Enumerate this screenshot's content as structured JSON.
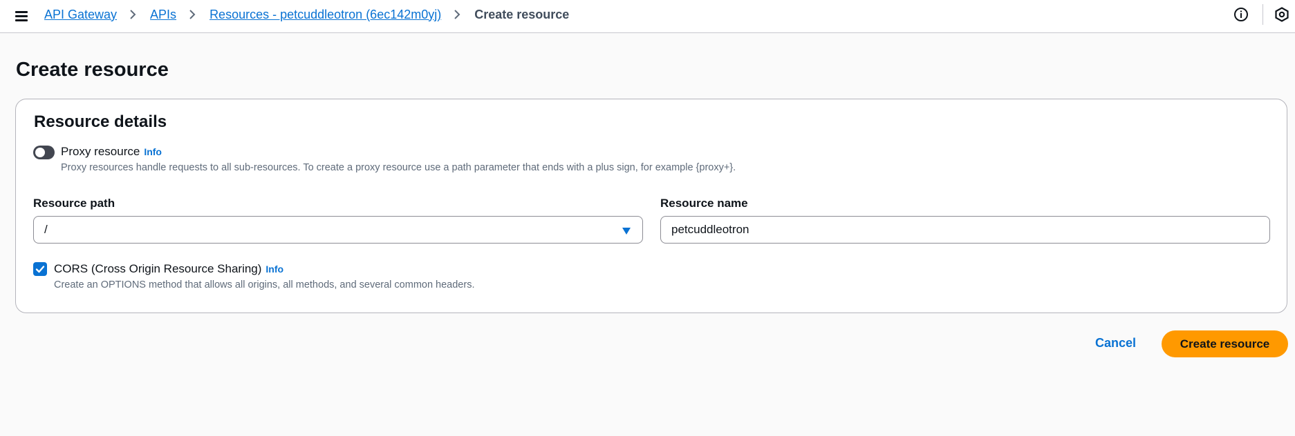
{
  "header": {
    "menu_icon": "hamburger-menu-icon",
    "breadcrumbs": [
      {
        "label": "API Gateway"
      },
      {
        "label": "APIs"
      },
      {
        "label": "Resources - petcuddleotron (6ec142m0yj)"
      },
      {
        "label": "Create resource"
      }
    ],
    "right_icons": [
      "info-circle-icon",
      "settings-hexagon-icon"
    ]
  },
  "page": {
    "title": "Create resource"
  },
  "resource_details": {
    "title": "Resource details",
    "proxy": {
      "label": "Proxy resource",
      "info": "Info",
      "description": "Proxy resources handle requests to all sub-resources. To create a proxy resource use a path parameter that ends with a plus sign, for example {proxy+}.",
      "enabled": false
    },
    "resource_path": {
      "label": "Resource path",
      "value": "/"
    },
    "resource_name": {
      "label": "Resource name",
      "value": "petcuddleotron"
    },
    "cors": {
      "label": "CORS (Cross Origin Resource Sharing)",
      "info": "Info",
      "description": "Create an OPTIONS method that allows all origins, all methods, and several common headers.",
      "checked": true
    }
  },
  "actions": {
    "cancel": "Cancel",
    "submit": "Create resource"
  },
  "colors": {
    "link": "#0972d3",
    "primary_button": "#ff9900",
    "background": "#fafafa"
  }
}
